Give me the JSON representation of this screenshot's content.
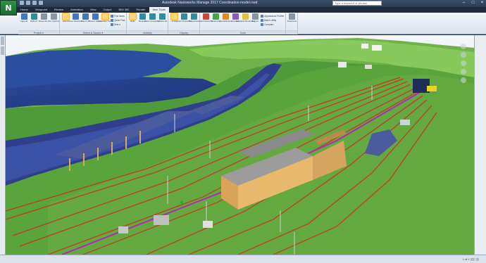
{
  "app": {
    "logo_letter": "N",
    "title": "Autodesk Navisworks Manage 2017   Coordination-model.nwd",
    "search_placeholder": "Type a keyword or phrase"
  },
  "tabs": [
    "Home",
    "Viewpoint",
    "Review",
    "Animation",
    "View",
    "Output",
    "BIM 360",
    "Render",
    "Item Tools"
  ],
  "active_tab": "Item Tools",
  "ribbon": {
    "groups": [
      {
        "label": "Project ▾",
        "tools": [
          {
            "name": "append",
            "label": "Append",
            "color": "blue"
          },
          {
            "name": "refresh",
            "label": "Refresh",
            "color": "teal"
          },
          {
            "name": "reset-all",
            "label": "Reset All...",
            "color": "gray"
          },
          {
            "name": "file-options",
            "label": "File Options",
            "color": "gray"
          }
        ]
      },
      {
        "label": "Select & Search ▾",
        "tools": [
          {
            "name": "select",
            "label": "Select",
            "color": "blue",
            "selected": true
          },
          {
            "name": "save-selection",
            "label": "Save Selection",
            "color": "blue"
          },
          {
            "name": "select-all",
            "label": "Select All",
            "color": "blue"
          },
          {
            "name": "select-same",
            "label": "Select Same",
            "color": "blue"
          },
          {
            "name": "selection-tree",
            "label": "Selection Tree",
            "color": "blue",
            "selected": true
          }
        ],
        "small": [
          "Find Items",
          "Quick Find",
          "Sets ▾"
        ]
      },
      {
        "label": "Visibility",
        "tools": [
          {
            "name": "hide",
            "label": "Hide",
            "color": "blue",
            "selected": true
          },
          {
            "name": "require",
            "label": "Require",
            "color": "teal"
          },
          {
            "name": "hide-unselected",
            "label": "Hide Unselected",
            "color": "teal"
          },
          {
            "name": "unhide-all",
            "label": "Unhide All",
            "color": "teal"
          }
        ]
      },
      {
        "label": "Display",
        "tools": [
          {
            "name": "links",
            "label": "Links",
            "color": "teal",
            "selected": true
          },
          {
            "name": "quick-properties",
            "label": "Quick Properties",
            "color": "teal"
          },
          {
            "name": "properties",
            "label": "Properties",
            "color": "teal"
          }
        ]
      },
      {
        "label": "Tools",
        "tools": [
          {
            "name": "clash-detective",
            "label": "Clash Detective",
            "color": "red"
          },
          {
            "name": "timeliner",
            "label": "TimeLiner",
            "color": "green"
          },
          {
            "name": "quantification",
            "label": "Quantification",
            "color": "orange"
          },
          {
            "name": "animator",
            "label": "Animator",
            "color": "purple"
          },
          {
            "name": "autodesk-rendering",
            "label": "Autodesk Rendering",
            "color": "yellow"
          },
          {
            "name": "scripter",
            "label": "Scripter",
            "color": "gray"
          }
        ],
        "small": [
          "Appearance Profiler",
          "Batch Utility",
          "Compare"
        ]
      },
      {
        "label": "",
        "tools": [
          {
            "name": "datatools",
            "label": "DataTools",
            "color": "gray"
          }
        ]
      }
    ]
  },
  "status": {
    "right": "1 of 1   ▯▯▯   ▯▯"
  }
}
